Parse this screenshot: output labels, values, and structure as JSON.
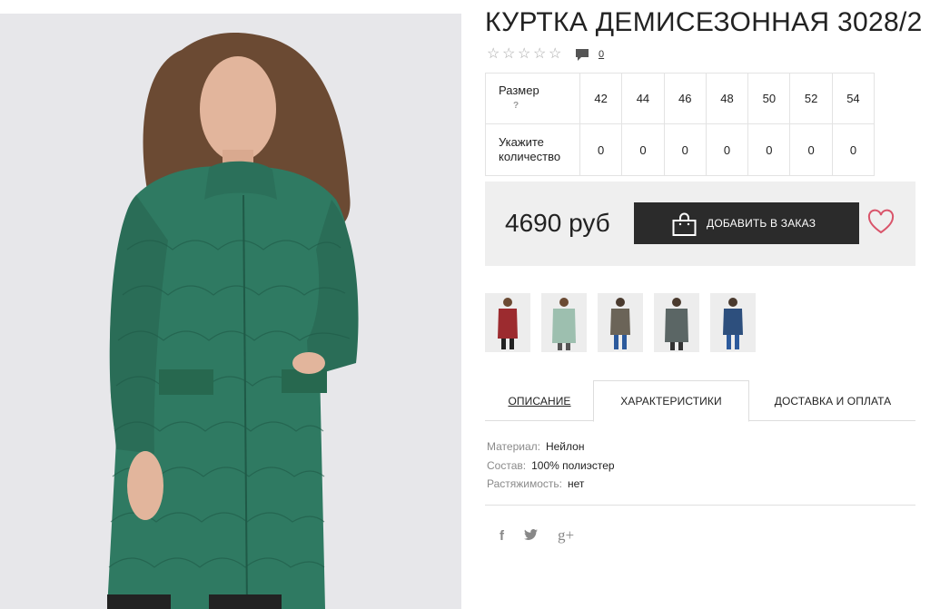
{
  "product": {
    "title": "КУРТКА ДЕМИСЕЗОННАЯ 3028/2",
    "rating_stars": 0,
    "comments_count": "0"
  },
  "sizes": {
    "size_label": "Размер",
    "size_help": "?",
    "qty_label_1": "Укажите",
    "qty_label_2": "количество",
    "values": [
      "42",
      "44",
      "46",
      "48",
      "50",
      "52",
      "54"
    ],
    "quantities": [
      "0",
      "0",
      "0",
      "0",
      "0",
      "0",
      "0"
    ]
  },
  "buy": {
    "price": "4690 руб",
    "add_button": "ДОБАВИТЬ В ЗАКАЗ"
  },
  "thumbnails": [
    {
      "color": "#9c2b2f"
    },
    {
      "color": "#9dbfaf"
    },
    {
      "color": "#6b6458"
    },
    {
      "color": "#5b6665"
    },
    {
      "color": "#2d4f7d"
    }
  ],
  "tabs": {
    "description": "ОПИСАНИЕ",
    "characteristics": "ХАРАКТЕРИСТИКИ",
    "delivery": "ДОСТАВКА И ОПЛАТА"
  },
  "specs": [
    {
      "key": "Материал:",
      "value": "Нейлон"
    },
    {
      "key": "Состав:",
      "value": "100% полиэстер"
    },
    {
      "key": "Растяжимость:",
      "value": "нет"
    }
  ],
  "social": {
    "facebook": "f",
    "twitter": "t",
    "googleplus": "g+"
  },
  "colors": {
    "coat": "#2f7a62",
    "button_bg": "#2b2b2b",
    "heart": "#d9546a"
  }
}
